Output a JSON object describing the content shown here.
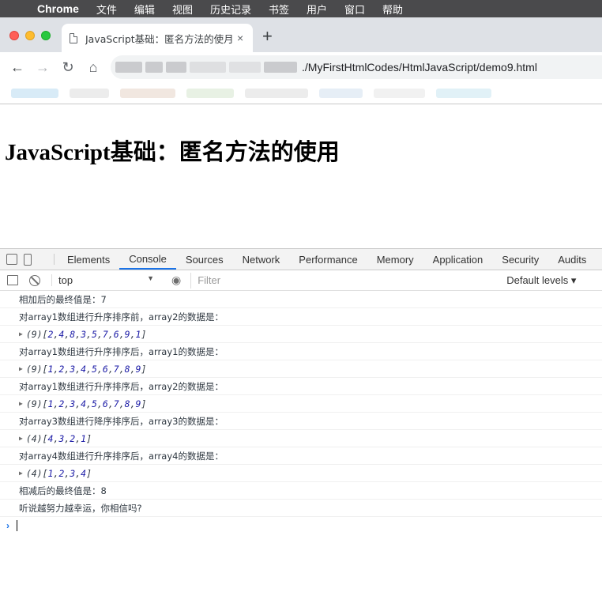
{
  "menubar": {
    "app": "Chrome",
    "items": [
      "文件",
      "编辑",
      "视图",
      "历史记录",
      "书签",
      "用户",
      "窗口",
      "帮助"
    ]
  },
  "tab": {
    "title": "JavaScript基础：匿名方法的使月",
    "close": "×"
  },
  "toolbar": {
    "url_visible": "./MyFirstHtmlCodes/HtmlJavaScript/demo9.html"
  },
  "page": {
    "heading": "JavaScript基础：匿名方法的使用"
  },
  "devtools": {
    "tabs": [
      "Elements",
      "Console",
      "Sources",
      "Network",
      "Performance",
      "Memory",
      "Application",
      "Security",
      "Audits"
    ],
    "active_tab": "Console",
    "context": "top",
    "filter_placeholder": "Filter",
    "levels": "Default levels ▾"
  },
  "console": {
    "lines": [
      {
        "type": "text",
        "text": "相加后的最终值是：7"
      },
      {
        "type": "text",
        "text": "对array1数组进行升序排序前，array2的数据是："
      },
      {
        "type": "array",
        "count": "(9)",
        "values": [
          "2",
          "4",
          "8",
          "3",
          "5",
          "7",
          "6",
          "9",
          "1"
        ]
      },
      {
        "type": "text",
        "text": "对array1数组进行升序排序后，array1的数据是："
      },
      {
        "type": "array",
        "count": "(9)",
        "values": [
          "1",
          "2",
          "3",
          "4",
          "5",
          "6",
          "7",
          "8",
          "9"
        ]
      },
      {
        "type": "text",
        "text": "对array1数组进行升序排序后，array2的数据是："
      },
      {
        "type": "array",
        "count": "(9)",
        "values": [
          "1",
          "2",
          "3",
          "4",
          "5",
          "6",
          "7",
          "8",
          "9"
        ]
      },
      {
        "type": "text",
        "text": "对array3数组进行降序排序后，array3的数据是："
      },
      {
        "type": "array",
        "count": "(4)",
        "values": [
          "4",
          "3",
          "2",
          "1"
        ]
      },
      {
        "type": "text",
        "text": "对array4数组进行升序排序后，array4的数据是："
      },
      {
        "type": "array",
        "count": "(4)",
        "values": [
          "1",
          "2",
          "3",
          "4"
        ]
      },
      {
        "type": "text",
        "text": "相减后的最终值是：8"
      },
      {
        "type": "text",
        "text": "听说越努力越幸运，你相信吗?"
      }
    ]
  }
}
